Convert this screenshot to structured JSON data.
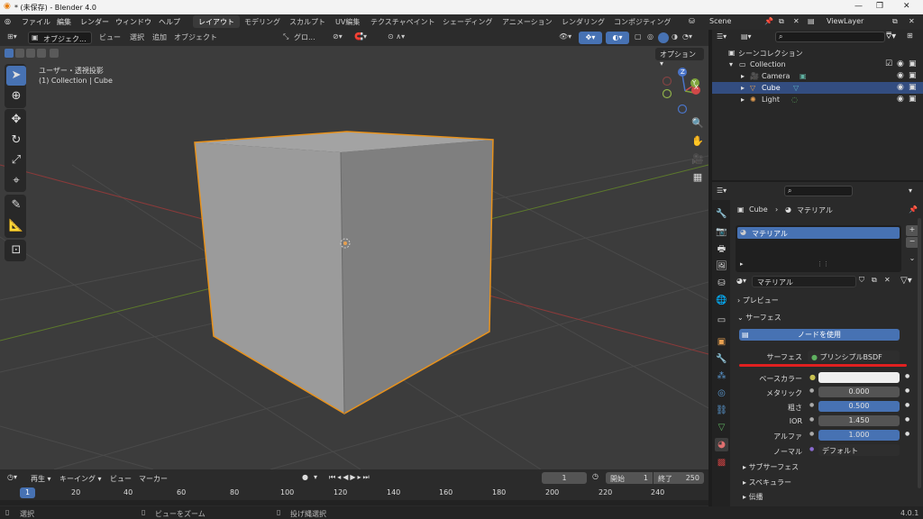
{
  "window": {
    "title": "* (未保存) - Blender 4.0",
    "minimize": "—",
    "maximize": "❐",
    "close": "✕"
  },
  "menu": {
    "items": [
      "ファイル",
      "編集",
      "レンダー",
      "ウィンドウ",
      "ヘルプ"
    ]
  },
  "workspaces": [
    "レイアウト",
    "モデリング",
    "スカルプト",
    "UV編集",
    "テクスチャペイント",
    "シェーディング",
    "アニメーション",
    "レンダリング",
    "コンポジティング"
  ],
  "scene": {
    "name": "Scene",
    "view_layer": "ViewLayer"
  },
  "viewport": {
    "mode": "オブジェク...",
    "menus": [
      "ビュー",
      "選択",
      "追加",
      "オブジェクト"
    ],
    "transform": "グロ...",
    "options": "オプション",
    "view_name": "ユーザー・透視投影",
    "context": "(1) Collection | Cube",
    "gizmo": {
      "x": "X",
      "y": "Y",
      "z": "Z"
    }
  },
  "outliner": {
    "root": "シーンコレクション",
    "collection": "Collection",
    "items": [
      "Camera",
      "Cube",
      "Light"
    ]
  },
  "properties": {
    "object": "Cube",
    "material_tab": "マテリアル",
    "slot": "マテリアル",
    "material_name": "マテリアル",
    "preview": "プレビュー",
    "surface": "サーフェス",
    "use_nodes": "ノードを使用",
    "fields": {
      "surface_lbl": "サーフェス",
      "surface_val": "プリンシプルBSDF",
      "base_lbl": "ベースカラー",
      "metal_lbl": "メタリック",
      "metal_val": "0.000",
      "rough_lbl": "粗さ",
      "rough_val": "0.500",
      "ior_lbl": "IOR",
      "ior_val": "1.450",
      "alpha_lbl": "アルファ",
      "alpha_val": "1.000",
      "normal_lbl": "ノーマル",
      "normal_val": "デフォルト"
    },
    "subsections": [
      "サブサーフェス",
      "スペキュラー",
      "伝播"
    ]
  },
  "timeline": {
    "menus": [
      "再生",
      "キーイング",
      "ビュー",
      "マーカー"
    ],
    "frame": "1",
    "start_lbl": "開始",
    "start": "1",
    "end_lbl": "終了",
    "end": "250",
    "ticks": [
      "1",
      "20",
      "40",
      "60",
      "80",
      "100",
      "120",
      "140",
      "160",
      "180",
      "200",
      "220",
      "240"
    ]
  },
  "status": {
    "select": "選択",
    "zoom": "ビューをズーム",
    "lasso": "投げ縄選択",
    "version": "4.0.1"
  }
}
